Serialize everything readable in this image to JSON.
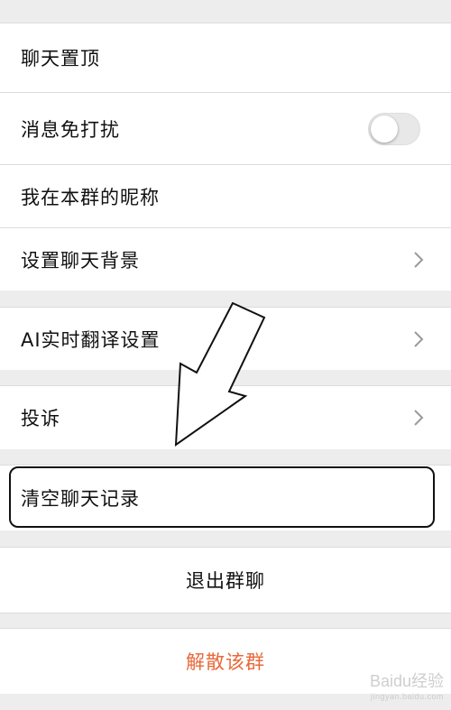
{
  "settings": {
    "pin_chat": "聊天置顶",
    "mute": "消息免打扰",
    "mute_enabled": false,
    "my_nickname": "我在本群的昵称",
    "background": "设置聊天背景",
    "ai_translate": "AI实时翻译设置",
    "complain": "投诉",
    "clear_history": "清空聊天记录",
    "exit_group": "退出群聊",
    "dismiss_group": "解散该群"
  },
  "colors": {
    "danger": "#e8693a",
    "page_bg": "#ededed"
  },
  "watermark": {
    "brand": "Baidu经验",
    "url": "jingyan.baidu.com"
  }
}
